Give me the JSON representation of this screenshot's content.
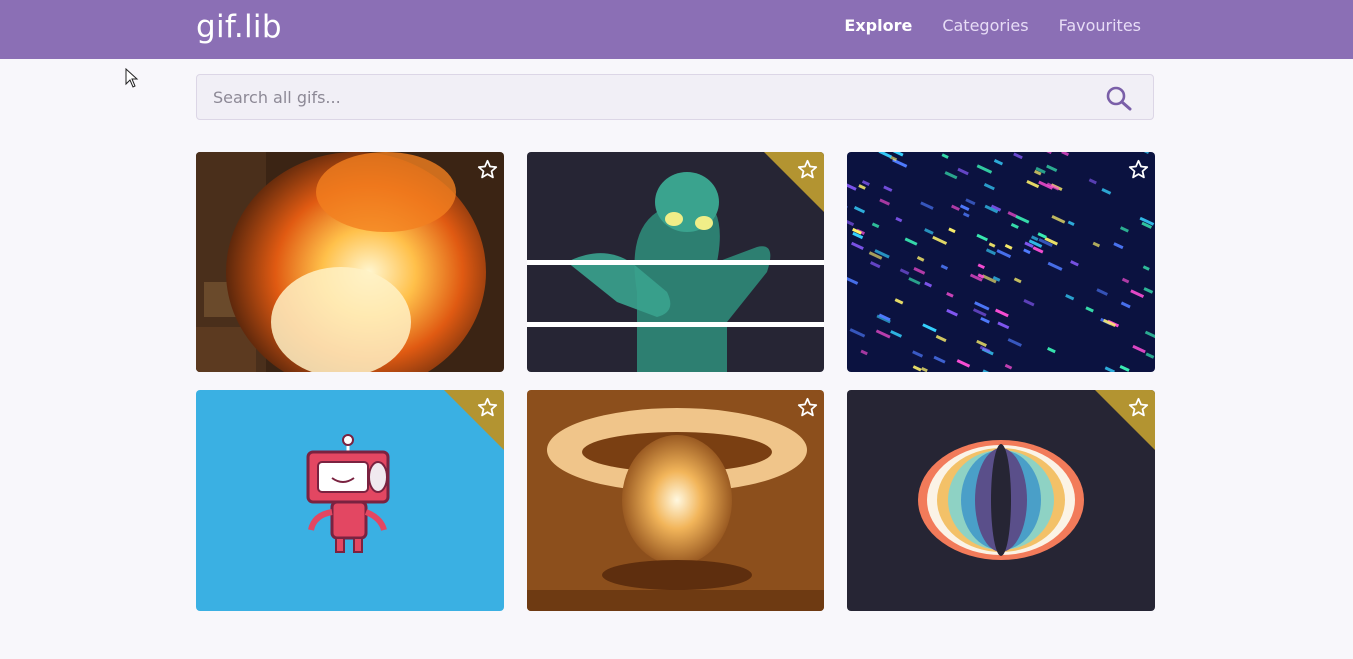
{
  "header": {
    "logo": "gif.lib",
    "nav": [
      {
        "label": "Explore",
        "active": true
      },
      {
        "label": "Categories",
        "active": false
      },
      {
        "label": "Favourites",
        "active": false
      }
    ]
  },
  "search": {
    "placeholder": "Search all gifs...",
    "value": "",
    "icon": "search-icon"
  },
  "colors": {
    "brand": "#8b6fb5",
    "favourite_ribbon": "#b39431",
    "page_bg": "#f8f7fb"
  },
  "gifs": [
    {
      "subject": "fire explosion",
      "favourited": false
    },
    {
      "subject": "glowing robot hand",
      "favourited": true
    },
    {
      "subject": "colorful data stream",
      "favourited": false
    },
    {
      "subject": "cute red robot",
      "favourited": true
    },
    {
      "subject": "mushroom cloud",
      "favourited": false
    },
    {
      "subject": "rainbow ellipse",
      "favourited": true
    }
  ]
}
